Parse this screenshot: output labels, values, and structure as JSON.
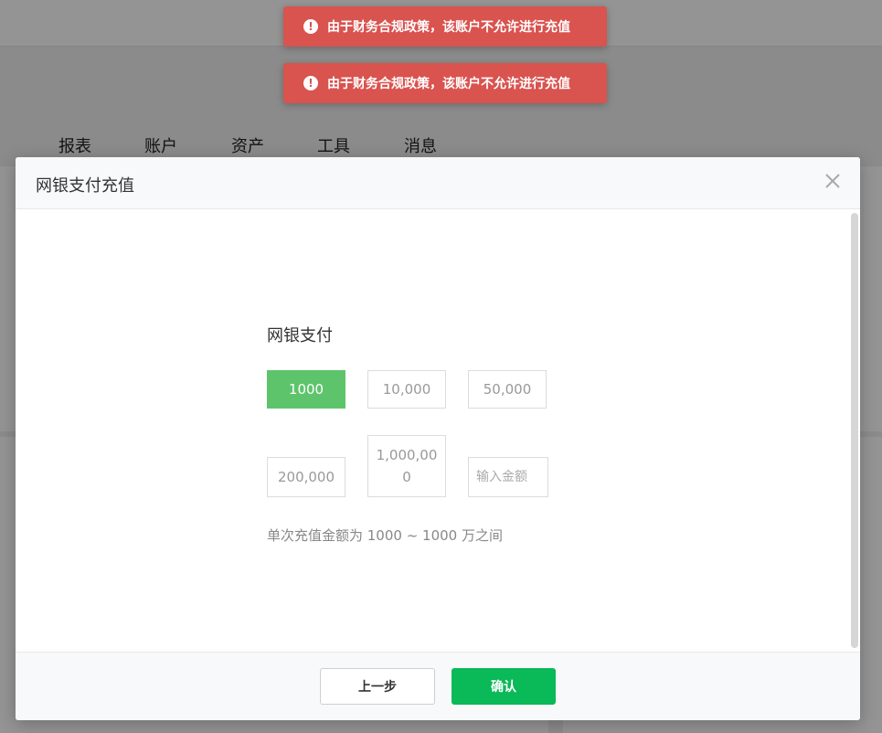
{
  "background": {
    "nav_items": [
      "报表",
      "账户",
      "资产",
      "工具",
      "消息"
    ]
  },
  "toasts": [
    {
      "icon": "exclamation-icon",
      "message": "由于财务合规政策，该账户不允许进行充值"
    },
    {
      "icon": "exclamation-icon",
      "message": "由于财务合规政策，该账户不允许进行充值"
    }
  ],
  "modal": {
    "title": "网银支付充值",
    "close_icon": "close-icon",
    "section_title": "网银支付",
    "amounts": [
      "1000",
      "10,000",
      "50,000",
      "200,000",
      "1,000,000"
    ],
    "selected_amount": "1000",
    "custom_amount_placeholder": "输入金额",
    "custom_amount_value": "",
    "hint": "单次充值金额为 1000 ~ 1000 万之间",
    "prev_button": "上一步",
    "confirm_button": "确认"
  },
  "colors": {
    "toast_bg": "#d9534f",
    "selected_amount_bg": "#5ec46c",
    "confirm_bg": "#0ab957"
  }
}
